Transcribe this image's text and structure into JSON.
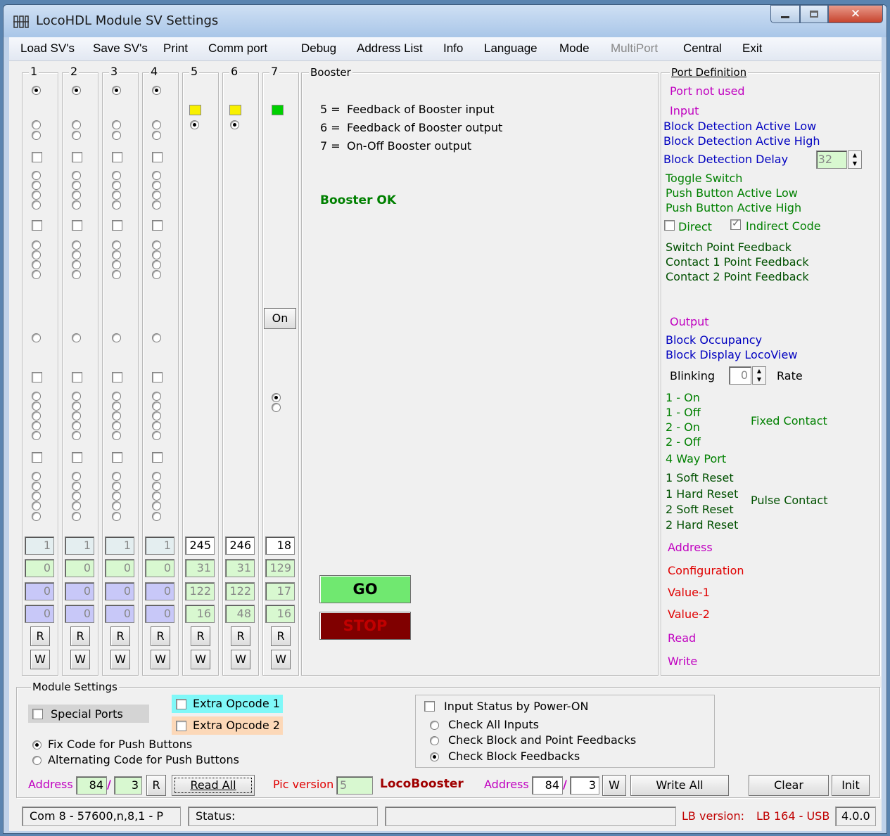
{
  "window": {
    "title": "LocoHDL Module SV Settings"
  },
  "menu": [
    "Load SV's",
    "Save SV's",
    "Print",
    "Comm port",
    "Debug",
    "Address List",
    "Info",
    "Language",
    "Mode",
    "MultiPort",
    "Central",
    "Exit"
  ],
  "ports": {
    "headers": [
      "1",
      "2",
      "3",
      "4",
      "5",
      "6",
      "7"
    ],
    "address": [
      "1",
      "1",
      "1",
      "1",
      "245",
      "246",
      "18"
    ],
    "config": [
      "0",
      "0",
      "0",
      "0",
      "31",
      "31",
      "129"
    ],
    "value1": [
      "0",
      "0",
      "0",
      "0",
      "122",
      "122",
      "17"
    ],
    "value2": [
      "0",
      "0",
      "0",
      "0",
      "16",
      "48",
      "16"
    ],
    "read_label": "R",
    "write_label": "W",
    "on_button": "On"
  },
  "booster": {
    "title": "Booster",
    "legend": [
      {
        "num": "5 =",
        "text": "Feedback of Booster input"
      },
      {
        "num": "6 =",
        "text": "Feedback of Booster output"
      },
      {
        "num": "7 =",
        "text": "On-Off Booster output"
      }
    ],
    "status": "Booster OK",
    "go_label": "GO",
    "stop_label": "STOP"
  },
  "port_definition": {
    "title": "Port Definition",
    "not_used": "Port not used",
    "input": "Input",
    "bd_low": "Block Detection Active Low",
    "bd_high": "Block Detection Active High",
    "bd_delay": "Block Detection Delay",
    "bd_delay_value": "32",
    "toggle": "Toggle Switch",
    "pb_low": "Push Button Active Low",
    "pb_high": "Push Button Active High",
    "direct": "Direct",
    "indirect": "Indirect Code",
    "switch_fb": "Switch Point Feedback",
    "contact1_fb": "Contact 1 Point Feedback",
    "contact2_fb": "Contact 2 Point Feedback",
    "output": "Output",
    "block_occ": "Block Occupancy",
    "block_disp": "Block Display LocoView",
    "blinking": "Blinking",
    "blink_value": "0",
    "rate": "Rate",
    "fixed": [
      "1 - On",
      "1 - Off",
      "2 - On",
      "2 - Off"
    ],
    "fixed_contact": "Fixed Contact",
    "four_way": "4 Way Port",
    "pulse": [
      "1 Soft Reset",
      "1 Hard Reset",
      "2 Soft Reset",
      "2 Hard Reset"
    ],
    "pulse_contact": "Pulse Contact",
    "address": "Address",
    "configuration": "Configuration",
    "value1": "Value-1",
    "value2": "Value-2",
    "read": "Read",
    "write": "Write"
  },
  "module": {
    "title": "Module Settings",
    "special_ports": "Special Ports",
    "extra1": "Extra Opcode 1",
    "extra2": "Extra Opcode 2",
    "fix_code": "Fix Code for Push Buttons",
    "alt_code": "Alternating Code for Push Buttons",
    "input_status": "Input Status by Power-ON",
    "check_all": "Check All Inputs",
    "check_block_point": "Check Block and Point Feedbacks",
    "check_block": "Check Block Feedbacks",
    "address_label": "Address",
    "addr1": "84",
    "addr2": "3",
    "r_label": "R",
    "read_all": "Read All",
    "pic_label": "Pic version",
    "pic_value": "5",
    "locobooster": "LocoBooster",
    "address2_label": "Address",
    "addr3": "84",
    "addr4": "3",
    "w_label": "W",
    "write_all": "Write All",
    "clear": "Clear",
    "init": "Init"
  },
  "statusbar": {
    "com": "Com 8 - 57600,n,8,1 - P",
    "status": "Status:",
    "lb_label": "LB version:",
    "lb_value": "LB 164 - USB",
    "version": "4.0.0"
  },
  "colors": {
    "green_field": "#d8f8d0",
    "blue_field": "#c8c8f8",
    "gray_field": "#e4eef0",
    "purple": "#c000c0",
    "blue": "#0000c0",
    "green": "#008000",
    "dkgreen": "#005000",
    "red": "#e00000",
    "go": "#70e870",
    "stop": "#800000"
  }
}
